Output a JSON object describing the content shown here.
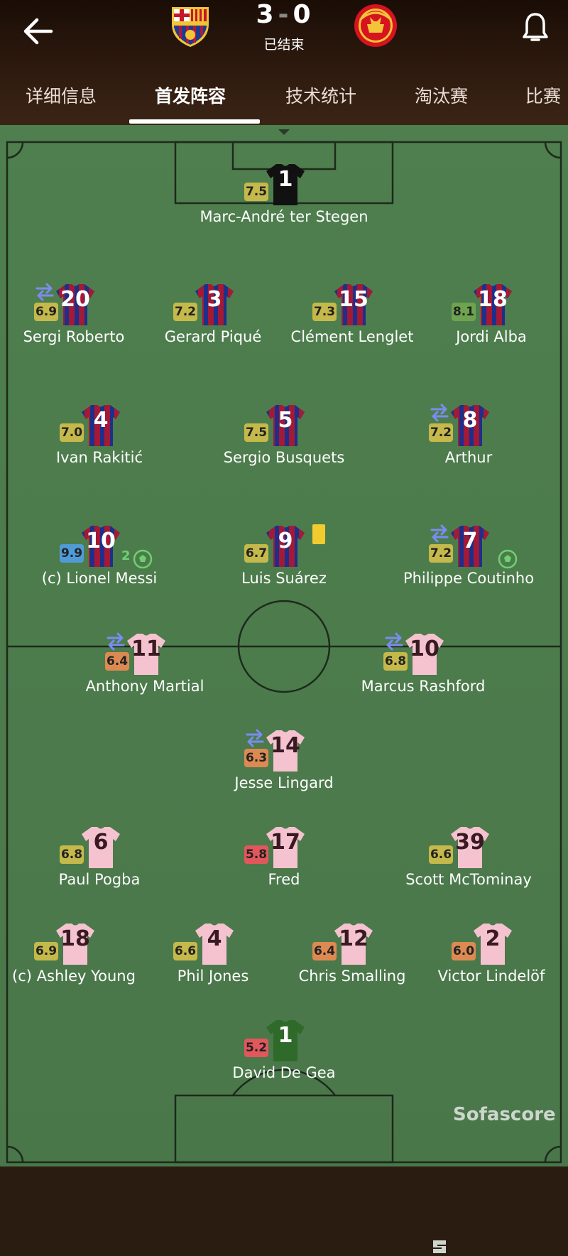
{
  "match": {
    "home_score": "3",
    "away_score": "0",
    "separator": "-",
    "status": "已结束",
    "home_team": "FC Barcelona",
    "away_team": "Manchester United"
  },
  "tabs": [
    {
      "label": "详细信息"
    },
    {
      "label": "首发阵容"
    },
    {
      "label": "技术统计"
    },
    {
      "label": "淘汰赛"
    },
    {
      "label": "比赛"
    }
  ],
  "active_tab": "首发阵容",
  "colors": {
    "rating_yellow": "#c4b94a",
    "rating_green": "#6ea34f",
    "rating_blue": "#4f9bd7",
    "rating_orange": "#dd8a52",
    "rating_red": "#e2575b",
    "home_shirt_blue": "#1d2f8a",
    "home_shirt_red": "#a21a36",
    "away_shirt": "#f4c3cf",
    "pitch": "#4b7a4a"
  },
  "home_players": [
    {
      "number": "1",
      "name": "Marc-André ter Stegen",
      "rating": "7.5",
      "rating_color": "yellow",
      "keeper": true
    },
    {
      "number": "20",
      "name": "Sergi Roberto",
      "rating": "6.9",
      "rating_color": "yellow",
      "sub": true
    },
    {
      "number": "3",
      "name": "Gerard Piqué",
      "rating": "7.2",
      "rating_color": "yellow"
    },
    {
      "number": "15",
      "name": "Clément Lenglet",
      "rating": "7.3",
      "rating_color": "yellow"
    },
    {
      "number": "18",
      "name": "Jordi Alba",
      "rating": "8.1",
      "rating_color": "green"
    },
    {
      "number": "4",
      "name": "Ivan Rakitić",
      "rating": "7.0",
      "rating_color": "yellow"
    },
    {
      "number": "5",
      "name": "Sergio Busquets",
      "rating": "7.5",
      "rating_color": "yellow"
    },
    {
      "number": "8",
      "name": "Arthur",
      "rating": "7.2",
      "rating_color": "yellow",
      "sub": true
    },
    {
      "number": "10",
      "name": "(c) Lionel Messi",
      "rating": "9.9",
      "rating_color": "blue",
      "goals": "2"
    },
    {
      "number": "9",
      "name": "Luis Suárez",
      "rating": "6.7",
      "rating_color": "yellow",
      "yellow_card": true
    },
    {
      "number": "7",
      "name": "Philippe Coutinho",
      "rating": "7.2",
      "rating_color": "yellow",
      "sub": true,
      "goal": true
    }
  ],
  "away_players": [
    {
      "number": "11",
      "name": "Anthony Martial",
      "rating": "6.4",
      "rating_color": "orange",
      "sub": true
    },
    {
      "number": "10",
      "name": "Marcus Rashford",
      "rating": "6.8",
      "rating_color": "yellow",
      "sub": true
    },
    {
      "number": "14",
      "name": "Jesse Lingard",
      "rating": "6.3",
      "rating_color": "orange",
      "sub": true
    },
    {
      "number": "6",
      "name": "Paul Pogba",
      "rating": "6.8",
      "rating_color": "yellow"
    },
    {
      "number": "17",
      "name": "Fred",
      "rating": "5.8",
      "rating_color": "red"
    },
    {
      "number": "39",
      "name": "Scott McTominay",
      "rating": "6.6",
      "rating_color": "yellow"
    },
    {
      "number": "18",
      "name": "(c) Ashley Young",
      "rating": "6.9",
      "rating_color": "yellow"
    },
    {
      "number": "4",
      "name": "Phil Jones",
      "rating": "6.6",
      "rating_color": "yellow"
    },
    {
      "number": "12",
      "name": "Chris Smalling",
      "rating": "6.4",
      "rating_color": "orange"
    },
    {
      "number": "2",
      "name": "Victor Lindelöf",
      "rating": "6.0",
      "rating_color": "orange"
    },
    {
      "number": "1",
      "name": "David De Gea",
      "rating": "5.2",
      "rating_color": "red",
      "keeper": true
    }
  ],
  "branding": {
    "name": "Sofascore"
  }
}
